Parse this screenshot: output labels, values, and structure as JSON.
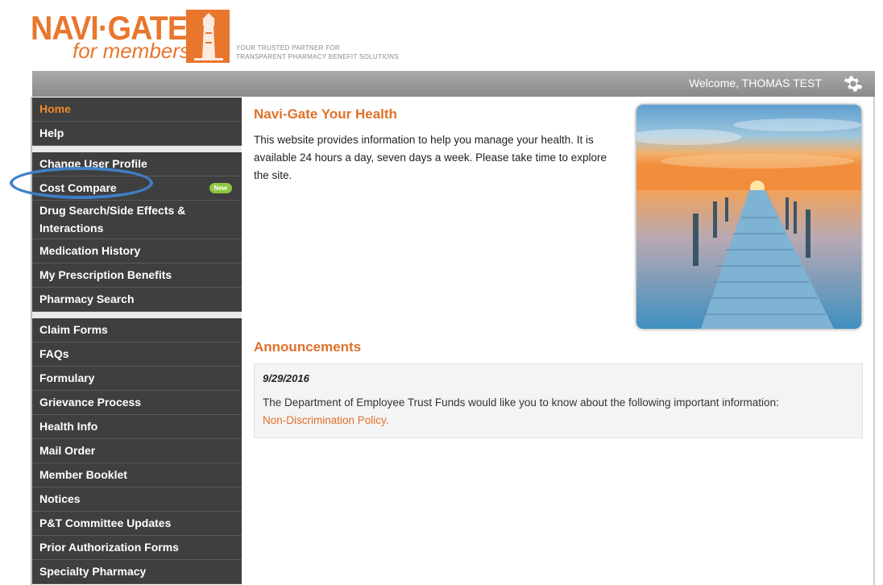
{
  "brand": {
    "logo_line1": "NAVI·GATE",
    "logo_line2": "for members",
    "tagline_line1": "YOUR TRUSTED PARTNER FOR",
    "tagline_line2": "TRANSPARENT PHARMACY BENEFIT SOLUTIONS",
    "accent_color": "#e8762d"
  },
  "topbar": {
    "welcome": "Welcome,  THOMAS TEST",
    "settings_icon": "gear-icon"
  },
  "sidebar": {
    "group1": [
      {
        "label": "Home",
        "active": true
      },
      {
        "label": "Help"
      }
    ],
    "group2": [
      {
        "label": "Change User Profile"
      },
      {
        "label": "Cost Compare",
        "badge": "New"
      },
      {
        "label": "Drug Search/Side Effects & Interactions"
      },
      {
        "label": "Medication History"
      },
      {
        "label": "My Prescription Benefits"
      },
      {
        "label": "Pharmacy Search"
      }
    ],
    "group3": [
      {
        "label": "Claim Forms"
      },
      {
        "label": "FAQs"
      },
      {
        "label": "Formulary"
      },
      {
        "label": "Grievance Process"
      },
      {
        "label": "Health Info"
      },
      {
        "label": "Mail Order"
      },
      {
        "label": "Member Booklet"
      },
      {
        "label": "Notices"
      },
      {
        "label": "P&T Committee Updates"
      },
      {
        "label": "Prior Authorization Forms"
      },
      {
        "label": "Specialty Pharmacy"
      }
    ]
  },
  "main": {
    "title": "Navi-Gate Your Health",
    "text": "This website provides information to help you manage your health. It is available 24 hours a day, seven days a week. Please take time to explore the site.",
    "announcements_title": "Announcements",
    "announcement": {
      "date": "9/29/2016",
      "text": "The Department of Employee Trust Funds would like you to know about the following important information:",
      "link": "Non-Discrimination Policy",
      "link_suffix": "."
    }
  }
}
